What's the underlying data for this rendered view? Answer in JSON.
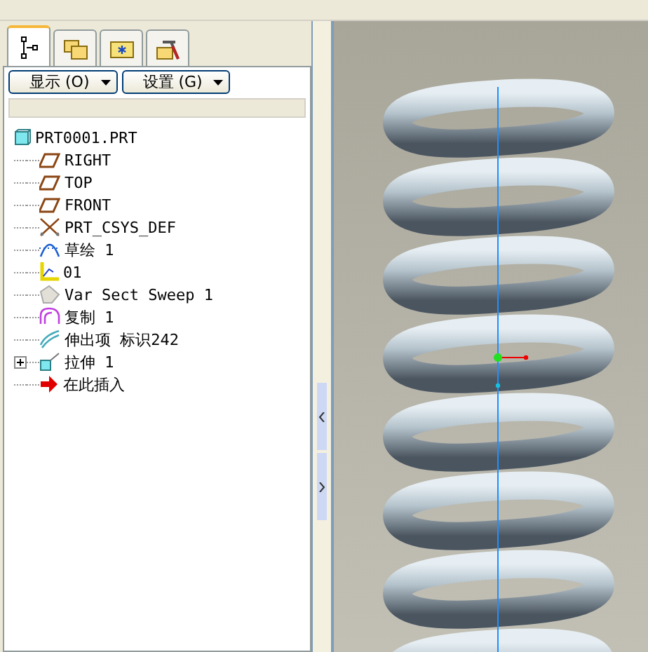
{
  "tabs": [
    {
      "kind": "tree",
      "selected": true
    },
    {
      "kind": "folders",
      "selected": false
    },
    {
      "kind": "favorites",
      "selected": false
    },
    {
      "kind": "tools",
      "selected": false
    }
  ],
  "buttons": [
    {
      "label": "显示 (O)"
    },
    {
      "label": "设置 (G)"
    }
  ],
  "tree": {
    "label": "PRT0001.PRT",
    "kind": "part",
    "children": [
      {
        "label": "RIGHT",
        "kind": "plane"
      },
      {
        "label": "TOP",
        "kind": "plane"
      },
      {
        "label": "FRONT",
        "kind": "plane"
      },
      {
        "label": "PRT_CSYS_DEF",
        "kind": "csys"
      },
      {
        "label": "草绘 1",
        "kind": "sketch"
      },
      {
        "label": "01",
        "kind": "graph"
      },
      {
        "label": "Var Sect Sweep 1",
        "kind": "sweep"
      },
      {
        "label": "复制 1",
        "kind": "copy"
      },
      {
        "label": "伸出项 标识242",
        "kind": "protrusion"
      },
      {
        "label": "拉伸 1",
        "kind": "extrude",
        "expanded": false
      },
      {
        "label": "在此插入",
        "kind": "insert"
      }
    ]
  }
}
